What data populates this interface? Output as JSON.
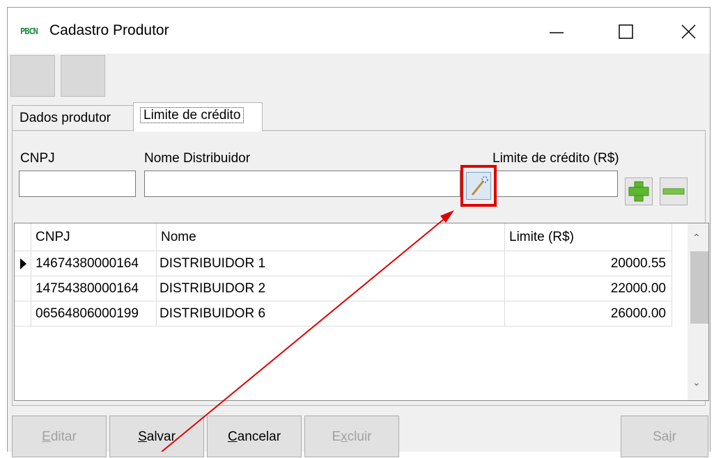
{
  "window": {
    "app_icon": "PBCN",
    "title": "Cadastro Produtor"
  },
  "tabs": [
    {
      "label": "Dados produtor"
    },
    {
      "label": "Limite de crédito"
    }
  ],
  "form": {
    "cnpj_label": "CNPJ",
    "cnpj_value": "",
    "nome_label": "Nome Distribuidor",
    "nome_value": "",
    "limite_label": "Limite de crédito (R$)",
    "limite_value": ""
  },
  "grid": {
    "columns": [
      "CNPJ",
      "Nome",
      "Limite (R$)"
    ],
    "rows": [
      {
        "cnpj": "14674380000164",
        "nome": "DISTRIBUIDOR 1",
        "limite": "20000.55"
      },
      {
        "cnpj": "14754380000164",
        "nome": "DISTRIBUIDOR 2",
        "limite": "22000.00"
      },
      {
        "cnpj": "06564806000199",
        "nome": "DISTRIBUIDOR 6",
        "limite": "26000.00"
      }
    ]
  },
  "buttons": {
    "editar": {
      "pre": "",
      "key": "E",
      "post": "ditar"
    },
    "salvar": {
      "pre": "",
      "key": "S",
      "post": "alvar"
    },
    "cancelar": {
      "pre": "",
      "key": "C",
      "post": "ancelar"
    },
    "excluir": {
      "pre": "E",
      "key": "x",
      "post": "cluir"
    },
    "sair": {
      "pre": "Sa",
      "key": "i",
      "post": "r"
    }
  },
  "colors": {
    "annotation": "#e00000",
    "plus": "#5cb82e",
    "minus": "#7cc24a"
  },
  "icons": [
    "minimize-icon",
    "maximize-icon",
    "close-icon",
    "search-icon",
    "plus-icon",
    "minus-icon",
    "row-pointer-icon",
    "scroll-up-icon",
    "scroll-down-icon"
  ]
}
